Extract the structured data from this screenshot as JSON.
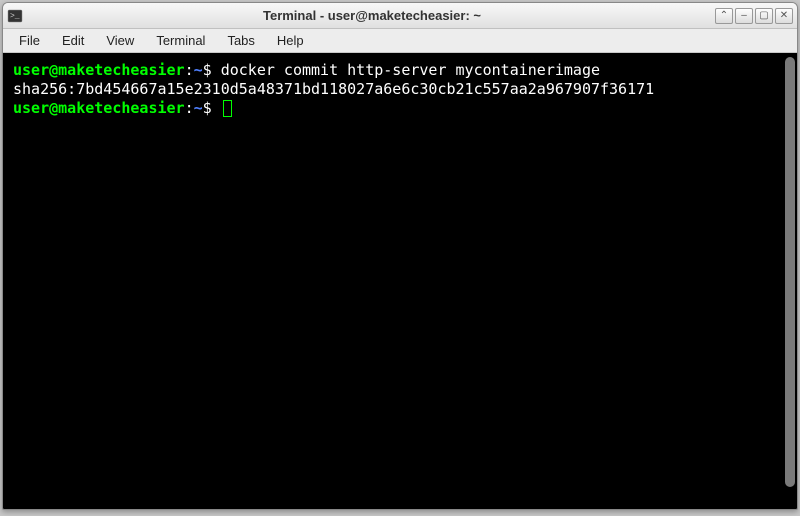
{
  "window": {
    "title": "Terminal - user@maketecheasier: ~"
  },
  "menubar": {
    "items": [
      "File",
      "Edit",
      "View",
      "Terminal",
      "Tabs",
      "Help"
    ]
  },
  "terminal": {
    "prompt_user": "user@maketecheasier",
    "prompt_sep": ":",
    "prompt_path": "~",
    "prompt_symbol": "$",
    "lines": [
      {
        "type": "prompt",
        "command": "docker commit http-server mycontainerimage"
      },
      {
        "type": "output",
        "text": "sha256:7bd454667a15e2310d5a48371bd118027a6e6c30cb21c557aa2a967907f36171"
      },
      {
        "type": "prompt",
        "command": ""
      }
    ]
  },
  "window_controls": {
    "up": "⌃",
    "minimize": "–",
    "maximize": "▢",
    "close": "✕"
  }
}
